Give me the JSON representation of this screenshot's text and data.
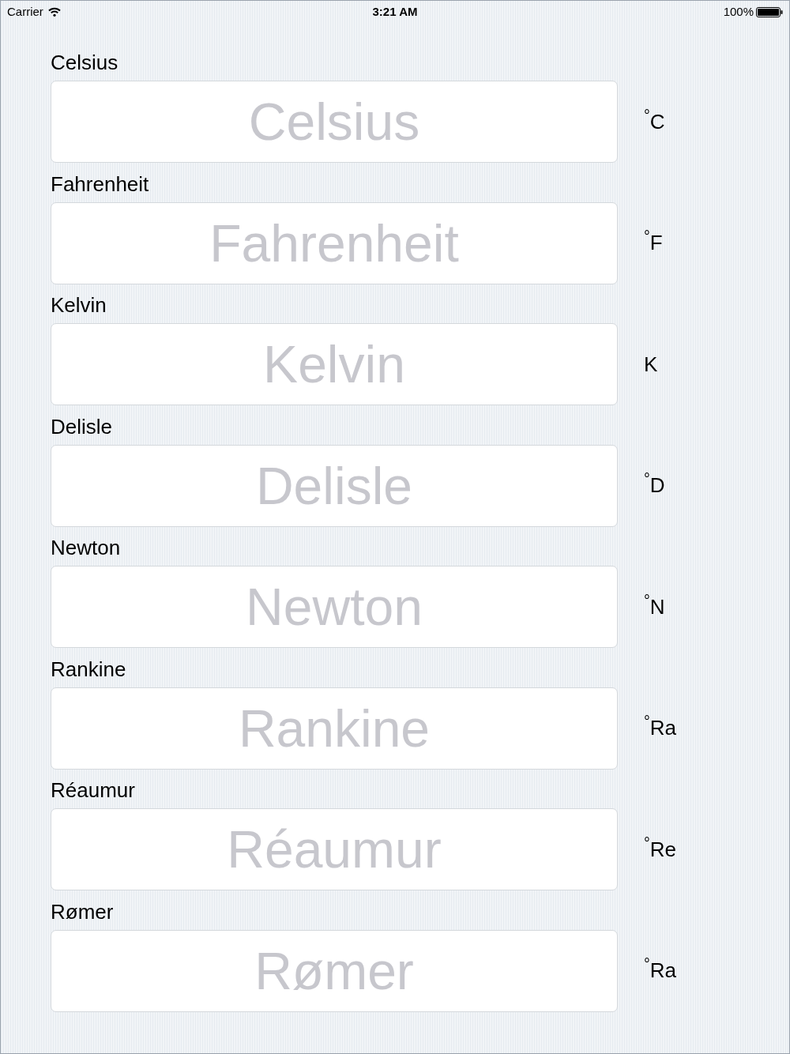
{
  "status_bar": {
    "carrier": "Carrier",
    "time": "3:21 AM",
    "battery": "100%"
  },
  "scales": [
    {
      "label": "Celsius",
      "placeholder": "Celsius",
      "unit": "$^{°}$C"
    },
    {
      "label": "Fahrenheit",
      "placeholder": "Fahrenheit",
      "unit": "$^{°}$F"
    },
    {
      "label": "Kelvin",
      "placeholder": "Kelvin",
      "unit": "K"
    },
    {
      "label": "Delisle",
      "placeholder": "Delisle",
      "unit": "$^{°}$D"
    },
    {
      "label": "Newton",
      "placeholder": "Newton",
      "unit": "$^{°}$N"
    },
    {
      "label": "Rankine",
      "placeholder": "Rankine",
      "unit": "$^{°}$Ra"
    },
    {
      "label": "Réaumur",
      "placeholder": "Réaumur",
      "unit": "$^{°}$Re"
    },
    {
      "label": "Rømer",
      "placeholder": "Rømer",
      "unit": "$^{°}$Ra"
    }
  ]
}
